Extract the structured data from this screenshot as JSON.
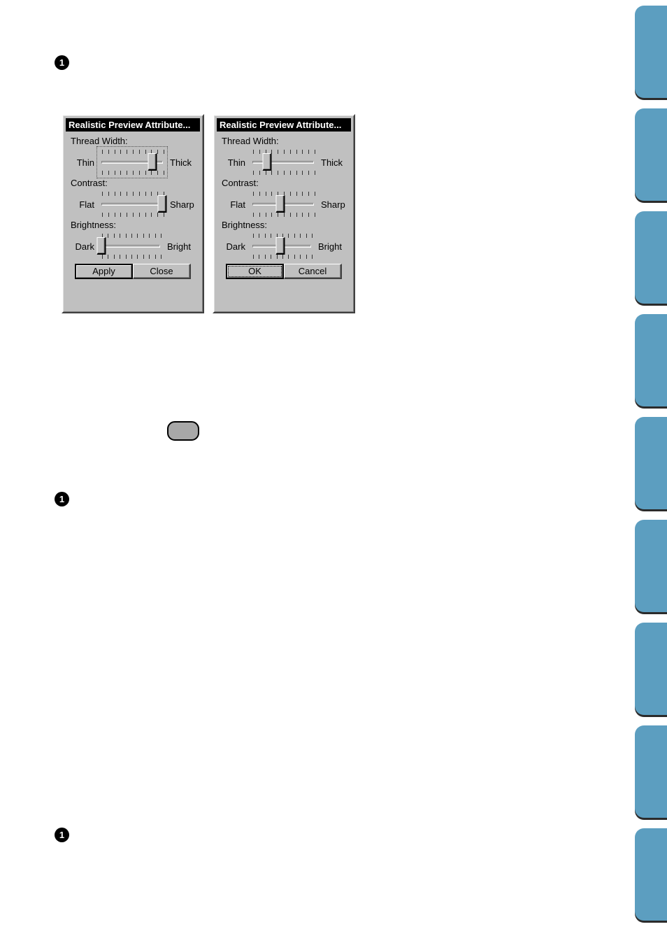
{
  "page": {
    "background": "#ffffff",
    "bullets": [
      {
        "label": "1"
      },
      {
        "label": "1"
      },
      {
        "label": "1"
      }
    ],
    "pill": {
      "fill": "#a8a8a8",
      "stroke": "#000000"
    },
    "tab_strip": {
      "color": "#5c9ec0",
      "shadow": "#2b2b2b",
      "count": 9
    }
  },
  "dialogs": [
    {
      "id": "dialog-apply-close",
      "title": "Realistic Preview Attribute...",
      "title_bar_color": "#000000",
      "title_text_color": "#ffffff",
      "face_color": "#c0c0c0",
      "sliders": [
        {
          "name": "thread-width",
          "label": "Thread Width:",
          "min_label": "Thin",
          "max_label": "Thick",
          "value_percent": 80,
          "ticks": 11,
          "focused": true
        },
        {
          "name": "contrast",
          "label": "Contrast:",
          "min_label": "Flat",
          "max_label": "Sharp",
          "value_percent": 95,
          "ticks": 11,
          "focused": false
        },
        {
          "name": "brightness",
          "label": "Brightness:",
          "min_label": "Dark",
          "max_label": "Bright",
          "value_percent": 4,
          "ticks": 11,
          "focused": false
        }
      ],
      "buttons": [
        {
          "name": "apply-button",
          "label": "Apply",
          "default": true,
          "focus": false
        },
        {
          "name": "close-button",
          "label": "Close",
          "default": false,
          "focus": false
        }
      ]
    },
    {
      "id": "dialog-ok-cancel",
      "title": "Realistic Preview Attribute...",
      "title_bar_color": "#000000",
      "title_text_color": "#ffffff",
      "face_color": "#c0c0c0",
      "sliders": [
        {
          "name": "thread-width",
          "label": "Thread Width:",
          "min_label": "Thin",
          "max_label": "Thick",
          "value_percent": 26,
          "ticks": 11,
          "focused": false
        },
        {
          "name": "contrast",
          "label": "Contrast:",
          "min_label": "Flat",
          "max_label": "Sharp",
          "value_percent": 46,
          "ticks": 11,
          "focused": false
        },
        {
          "name": "brightness",
          "label": "Brightness:",
          "min_label": "Dark",
          "max_label": "Bright",
          "value_percent": 48,
          "ticks": 11,
          "focused": false
        }
      ],
      "buttons": [
        {
          "name": "ok-button",
          "label": "OK",
          "default": true,
          "focus": true
        },
        {
          "name": "cancel-button",
          "label": "Cancel",
          "default": false,
          "focus": false
        }
      ]
    }
  ]
}
